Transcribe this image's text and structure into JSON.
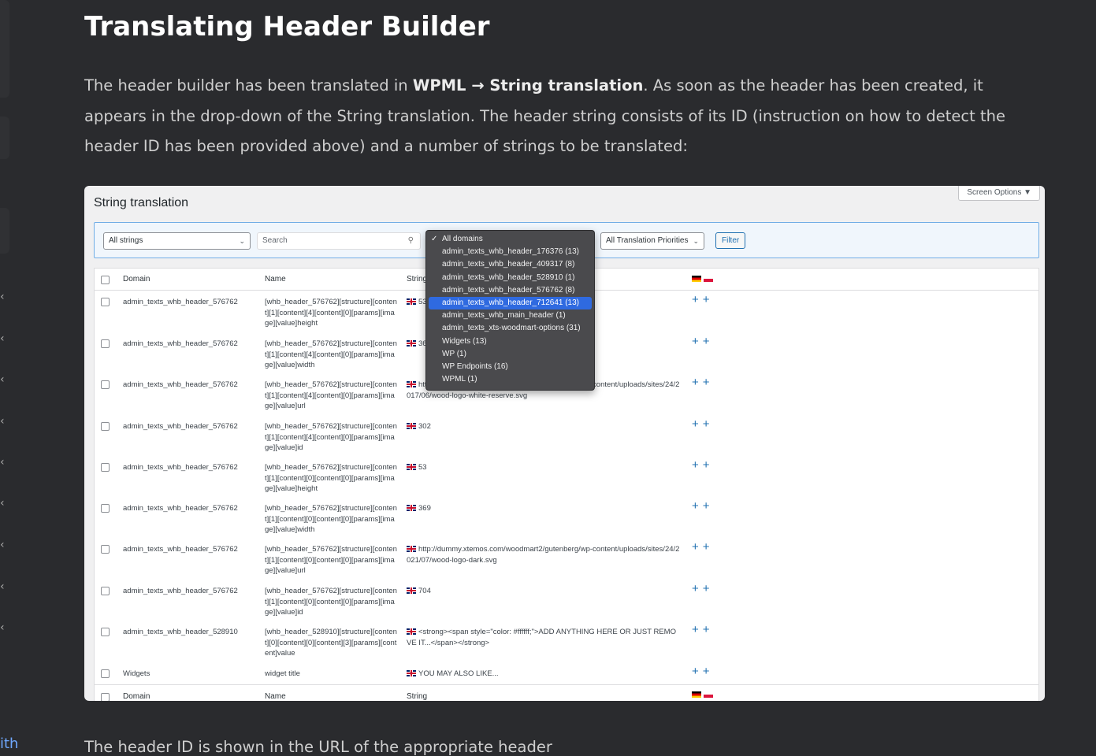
{
  "sidebar": {
    "chevron": "‹",
    "link_fragment": "ith"
  },
  "article": {
    "title": "Translating Header Builder",
    "intro_pre": "The header builder has been translated in ",
    "intro_bold": "WPML → String translation",
    "intro_post": ". As soon as the header has been created, it appears in the drop-down of the String translation. The header string consists of its ID (instruction on how to detect the header ID has been provided above) and a number of strings to be translated:",
    "outro": "The header ID is shown in the URL of the appropriate header"
  },
  "screenshot": {
    "title": "String translation",
    "screen_options": "Screen Options ▼",
    "filters": {
      "strings_select": "All strings",
      "search_placeholder": "Search",
      "priorities_select": "All Translation Priorities",
      "filter_button": "Filter"
    },
    "table": {
      "col_domain": "Domain",
      "col_name": "Name",
      "col_string": "String",
      "rows": [
        {
          "domain": "admin_texts_whb_header_576762",
          "name": "[whb_header_576762][structure][content][1][content][4][content][0][params][image][value]height",
          "string": "53"
        },
        {
          "domain": "admin_texts_whb_header_576762",
          "name": "[whb_header_576762][structure][content][1][content][4][content][0][params][image][value]width",
          "string": "36"
        },
        {
          "domain": "admin_texts_whb_header_576762",
          "name": "[whb_header_576762][structure][content][1][content][4][content][0][params][image][value]url",
          "string": "http://dummy.xtemos.com/woodmart2/gutenberg/wp-content/uploads/sites/24/2017/06/wood-logo-white-reserve.svg"
        },
        {
          "domain": "admin_texts_whb_header_576762",
          "name": "[whb_header_576762][structure][content][1][content][4][content][0][params][image][value]id",
          "string": "302"
        },
        {
          "domain": "admin_texts_whb_header_576762",
          "name": "[whb_header_576762][structure][content][1][content][0][content][0][params][image][value]height",
          "string": "53"
        },
        {
          "domain": "admin_texts_whb_header_576762",
          "name": "[whb_header_576762][structure][content][1][content][0][content][0][params][image][value]width",
          "string": "369"
        },
        {
          "domain": "admin_texts_whb_header_576762",
          "name": "[whb_header_576762][structure][content][1][content][0][content][0][params][image][value]url",
          "string": "http://dummy.xtemos.com/woodmart2/gutenberg/wp-content/uploads/sites/24/2021/07/wood-logo-dark.svg"
        },
        {
          "domain": "admin_texts_whb_header_576762",
          "name": "[whb_header_576762][structure][content][1][content][0][content][0][params][image][value]id",
          "string": "704"
        },
        {
          "domain": "admin_texts_whb_header_528910",
          "name": "[whb_header_528910][structure][content][0][content][0][content][3][params][content]value",
          "string": "<strong><span style=\"color: #ffffff;\">ADD ANYTHING HERE OR JUST REMOVE IT...</span></strong>"
        },
        {
          "domain": "Widgets",
          "name": "widget title",
          "string": "YOU MAY ALSO LIKE..."
        }
      ]
    },
    "domains_dropdown": {
      "selected_index": 0,
      "active_index": 5,
      "options": [
        "All domains",
        "admin_texts_whb_header_176376 (13)",
        "admin_texts_whb_header_409317 (8)",
        "admin_texts_whb_header_528910 (1)",
        "admin_texts_whb_header_576762 (8)",
        "admin_texts_whb_header_712641 (13)",
        "admin_texts_whb_main_header (1)",
        "admin_texts_xts-woodmart-options (31)",
        "Widgets (13)",
        "WP (1)",
        "WP Endpoints (16)",
        "WPML (1)"
      ]
    },
    "icons": {
      "plus": "+",
      "search": "magnifier-icon",
      "caret": "chevron-down-icon",
      "check": "✓"
    }
  }
}
